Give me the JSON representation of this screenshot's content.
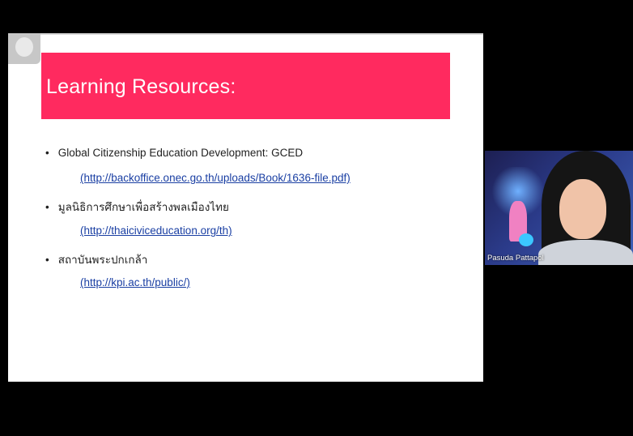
{
  "slide": {
    "title": "Learning Resources:",
    "resources": [
      {
        "name": "Global Citizenship Education Development: GCED",
        "url": "(http://backoffice.onec.go.th/uploads/Book/1636-file.pdf)"
      },
      {
        "name": "มูลนิธิการศึกษาเพื่อสร้างพลเมืองไทย",
        "url": "(http://thaiciviceducation.org/th)"
      },
      {
        "name": "สถาบันพระปกเกล้า",
        "url": "(http://kpi.ac.th/public/)"
      }
    ],
    "bullet": "•",
    "colors": {
      "banner": "#ff2a5f",
      "link": "#1a3fa3"
    }
  },
  "participant": {
    "name": "Pasuda Pattapol"
  }
}
